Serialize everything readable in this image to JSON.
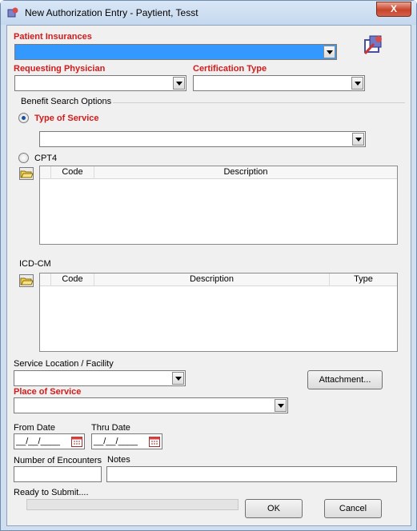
{
  "window": {
    "title": "New Authorization Entry - Paytient, Tesst",
    "close_label": "X"
  },
  "patient_insurances": {
    "label": "Patient Insurances",
    "value": ""
  },
  "requesting_physician": {
    "label": "Requesting Physician",
    "value": ""
  },
  "certification_type": {
    "label": "Certification Type",
    "value": ""
  },
  "benefit_search": {
    "group_label": "Benefit Search Options",
    "type_of_service_label": "Type of Service",
    "type_of_service_value": "",
    "cpt4_label": "CPT4",
    "selected_option": "Type of Service",
    "cpt4_columns": [
      "Code",
      "Description"
    ]
  },
  "icd_cm": {
    "label": "ICD-CM",
    "columns": [
      "Code",
      "Description",
      "Type"
    ]
  },
  "service_location": {
    "label": "Service Location / Facility",
    "value": ""
  },
  "attachment_button": "Attachment...",
  "place_of_service": {
    "label": "Place of Service",
    "value": ""
  },
  "from_date": {
    "label": "From Date",
    "value": "__/__/____"
  },
  "thru_date": {
    "label": "Thru Date",
    "value": "__/__/____"
  },
  "number_of_encounters": {
    "label": "Number of Encounters",
    "value": ""
  },
  "notes": {
    "label": "Notes",
    "value": ""
  },
  "status": {
    "text": "Ready to Submit....",
    "progress": 0
  },
  "ok_button": "OK",
  "cancel_button": "Cancel",
  "colors": {
    "required_label": "#d41a1a",
    "selection": "#3399ff",
    "title_bar": "#cfdff0"
  }
}
